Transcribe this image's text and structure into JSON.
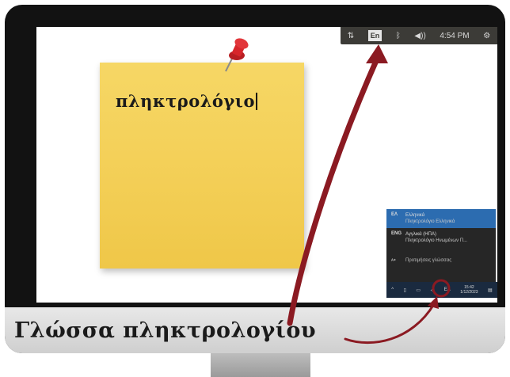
{
  "topbar": {
    "network_icon": "network-updown-icon",
    "language_indicator": "En",
    "bluetooth_icon": "bluetooth-icon",
    "volume_icon": "volume-icon",
    "clock": "4:54 PM",
    "settings_icon": "gear-icon"
  },
  "note": {
    "text": "πληκτρολόγιο",
    "color": "#f3ce55",
    "pin_color": "#d7262b"
  },
  "lang_popup": {
    "items": [
      {
        "code": "ΕΛ",
        "name": "Ελληνικά",
        "layout": "Πληκτρολόγιο Ελληνικά",
        "selected": true
      },
      {
        "code": "ENG",
        "name": "Αγγλικά (ΗΠΑ)",
        "layout": "Πληκτρολόγιο Ηνωμένων Π...",
        "selected": false
      }
    ],
    "preferences_label": "Προτιμήσεις γλώσσας"
  },
  "taskbar": {
    "language": "ΕΛ",
    "time": "15:42",
    "date": "1/12/2023"
  },
  "caption": {
    "text": "Γλώσσα πληκτρολογίου"
  },
  "colors": {
    "arrow": "#8b1a22",
    "bezel": "#121212",
    "panel": "#3c3b37"
  }
}
